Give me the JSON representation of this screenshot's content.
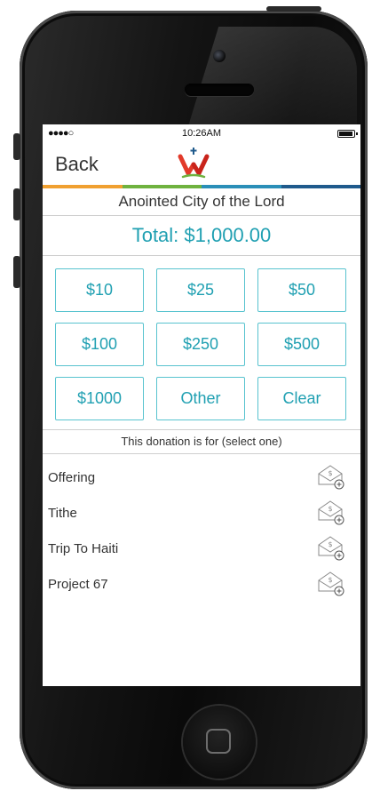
{
  "status_bar": {
    "signal": "●●●●○",
    "time": "10:26AM"
  },
  "nav": {
    "back_label": "Back"
  },
  "brand_colors": [
    "#f0a030",
    "#6fb23f",
    "#2a8fb8",
    "#1f5a8c"
  ],
  "accent_color": "#20a0b2",
  "church_name": "Anointed City of the Lord",
  "total_label": "Total: $1,000.00",
  "amounts": [
    "$10",
    "$25",
    "$50",
    "$100",
    "$250",
    "$500",
    "$1000",
    "Other",
    "Clear"
  ],
  "prompt": "This donation is for (select one)",
  "funds": [
    {
      "label": "Offering",
      "icon": "donation-envelope-icon"
    },
    {
      "label": "Tithe",
      "icon": "donation-envelope-icon"
    },
    {
      "label": "Trip To Haiti",
      "icon": "donation-envelope-icon"
    },
    {
      "label": "Project 67",
      "icon": "donation-envelope-icon"
    }
  ]
}
